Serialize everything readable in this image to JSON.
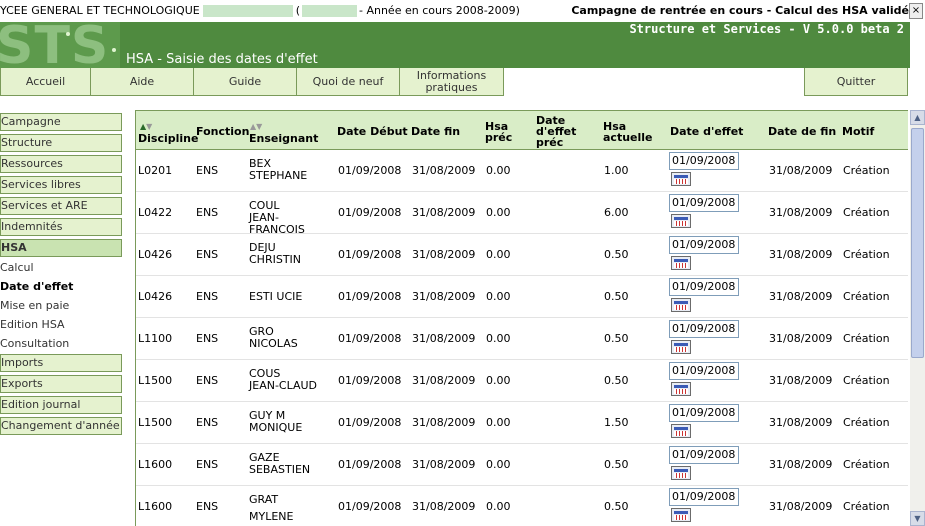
{
  "topbar": {
    "establishment": "YCEE GENERAL ET TECHNOLOGIQUE",
    "paren_open": "(",
    "year": "- Année en cours 2008-2009)",
    "campaign": "Campagne de rentrée en cours - Calcul des HSA validé",
    "close": "×"
  },
  "banner": {
    "logo_text": "STS",
    "version": "Structure et Services - V 5.0.0 beta 2",
    "page_title": "HSA - Saisie des dates d'effet"
  },
  "menu": {
    "accueil": "Accueil",
    "aide": "Aide",
    "guide": "Guide",
    "quoi_de_neuf": "Quoi de neuf",
    "informations": "Informations pratiques",
    "quitter": "Quitter"
  },
  "sidebar": {
    "items": [
      "Campagne",
      "Structure",
      "Ressources",
      "Services libres",
      "Services et ARE",
      "Indemnités",
      "HSA"
    ],
    "sub": [
      "Calcul",
      "Date d'effet",
      "Mise en paie",
      "Edition HSA",
      "Consultation"
    ],
    "items_after": [
      "Imports",
      "Exports",
      "Edition journal",
      "Changement d'année"
    ]
  },
  "table": {
    "headers": {
      "discipline": "Discipline",
      "fonction": "Fonction",
      "enseignant": "Enseignant",
      "date_debut": "Date Début",
      "date_fin": "Date fin",
      "hsa_prec": "Hsa préc",
      "date_effet_prec": "Date d'effet préc",
      "hsa_actuelle": "Hsa actuelle",
      "date_effet": "Date d'effet",
      "date_de_fin": "Date de fin",
      "motif": "Motif"
    },
    "rows": [
      {
        "discipline": "L0201",
        "fonction": "ENS",
        "nom": "BEX",
        "prenom": "STEPHANE",
        "prenom2": "",
        "debut": "01/09/2008",
        "fin": "31/08/2009",
        "hsa_prec": "0.00",
        "hsa": "1.00",
        "effet": "01/09/2008",
        "date_fin": "31/08/2009",
        "motif": "Création"
      },
      {
        "discipline": "L0422",
        "fonction": "ENS",
        "nom": "COUL",
        "prenom": "JEAN-",
        "prenom2": "FRANCOIS",
        "debut": "01/09/2008",
        "fin": "31/08/2009",
        "hsa_prec": "0.00",
        "hsa": "6.00",
        "effet": "01/09/2008",
        "date_fin": "31/08/2009",
        "motif": "Création"
      },
      {
        "discipline": "L0426",
        "fonction": "ENS",
        "nom": "DEJU",
        "prenom": "CHRISTIN",
        "prenom2": "",
        "debut": "01/09/2008",
        "fin": "31/08/2009",
        "hsa_prec": "0.00",
        "hsa": "0.50",
        "effet": "01/09/2008",
        "date_fin": "31/08/2009",
        "motif": "Création"
      },
      {
        "discipline": "L0426",
        "fonction": "ENS",
        "nom": "ESTI        UCIE",
        "prenom": "",
        "prenom2": "",
        "debut": "01/09/2008",
        "fin": "31/08/2009",
        "hsa_prec": "0.00",
        "hsa": "0.50",
        "effet": "01/09/2008",
        "date_fin": "31/08/2009",
        "motif": "Création"
      },
      {
        "discipline": "L1100",
        "fonction": "ENS",
        "nom": "GRO",
        "prenom": "NICOLAS",
        "prenom2": "",
        "debut": "01/09/2008",
        "fin": "31/08/2009",
        "hsa_prec": "0.00",
        "hsa": "0.50",
        "effet": "01/09/2008",
        "date_fin": "31/08/2009",
        "motif": "Création"
      },
      {
        "discipline": "L1500",
        "fonction": "ENS",
        "nom": "COUS",
        "prenom": "JEAN-CLAUD",
        "prenom2": "",
        "debut": "01/09/2008",
        "fin": "31/08/2009",
        "hsa_prec": "0.00",
        "hsa": "0.50",
        "effet": "01/09/2008",
        "date_fin": "31/08/2009",
        "motif": "Création"
      },
      {
        "discipline": "L1500",
        "fonction": "ENS",
        "nom": "GUY  M",
        "prenom": "MONIQUE",
        "prenom2": "",
        "debut": "01/09/2008",
        "fin": "31/08/2009",
        "hsa_prec": "0.00",
        "hsa": "1.50",
        "effet": "01/09/2008",
        "date_fin": "31/08/2009",
        "motif": "Création"
      },
      {
        "discipline": "L1600",
        "fonction": "ENS",
        "nom": "GAZE",
        "prenom": "SEBASTIEN",
        "prenom2": "",
        "debut": "01/09/2008",
        "fin": "31/08/2009",
        "hsa_prec": "0.00",
        "hsa": "0.50",
        "effet": "01/09/2008",
        "date_fin": "31/08/2009",
        "motif": "Création"
      },
      {
        "discipline": "L1600",
        "fonction": "ENS",
        "nom": "GRAT",
        "prenom": "",
        "prenom2": "MYLENE",
        "debut": "01/09/2008",
        "fin": "31/08/2009",
        "hsa_prec": "0.00",
        "hsa": "0.50",
        "effet": "01/09/2008",
        "date_fin": "31/08/2009",
        "motif": "Création"
      }
    ]
  },
  "colors": {
    "banner": "#4f8a3f",
    "menu_bg": "#e5f2cf",
    "header_bg": "#d9edc7",
    "border": "#7a9a5a"
  }
}
